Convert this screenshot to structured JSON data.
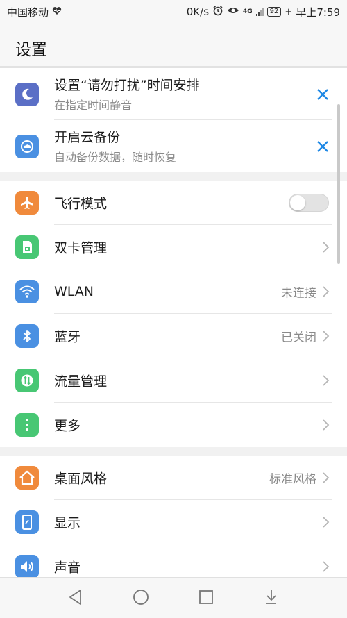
{
  "status_bar": {
    "carrier": "中国移动",
    "speed": "0K/s",
    "network": "4G",
    "battery": "92",
    "time": "早上7:59"
  },
  "header": {
    "title": "设置"
  },
  "suggestions": [
    {
      "title": "设置“请勿打扰”时间安排",
      "subtitle": "在指定时间静音",
      "icon": "moon-icon",
      "color": "#5b6fc6"
    },
    {
      "title": "开启云备份",
      "subtitle": "自动备份数据，随时恢复",
      "icon": "cloud-backup-icon",
      "color": "#4a90e2"
    }
  ],
  "group1": [
    {
      "label": "飞行模式",
      "icon": "airplane-icon",
      "color": "#f08a3c",
      "toggle": false
    },
    {
      "label": "双卡管理",
      "icon": "sim-card-icon",
      "color": "#48c774",
      "value": ""
    },
    {
      "label": "WLAN",
      "icon": "wifi-icon",
      "color": "#4a90e2",
      "value": "未连接"
    },
    {
      "label": "蓝牙",
      "icon": "bluetooth-icon",
      "color": "#4a90e2",
      "value": "已关闭"
    },
    {
      "label": "流量管理",
      "icon": "data-usage-icon",
      "color": "#48c774",
      "value": ""
    },
    {
      "label": "更多",
      "icon": "more-icon",
      "color": "#48c774",
      "value": ""
    }
  ],
  "group2": [
    {
      "label": "桌面风格",
      "icon": "home-style-icon",
      "color": "#f08a3c",
      "value": "标准风格"
    },
    {
      "label": "显示",
      "icon": "display-icon",
      "color": "#4a90e2",
      "value": ""
    },
    {
      "label": "声音",
      "icon": "sound-icon",
      "color": "#4a90e2",
      "value": ""
    }
  ],
  "colors": {
    "accent": "#1e88e5",
    "background": "#f5f5f5"
  }
}
